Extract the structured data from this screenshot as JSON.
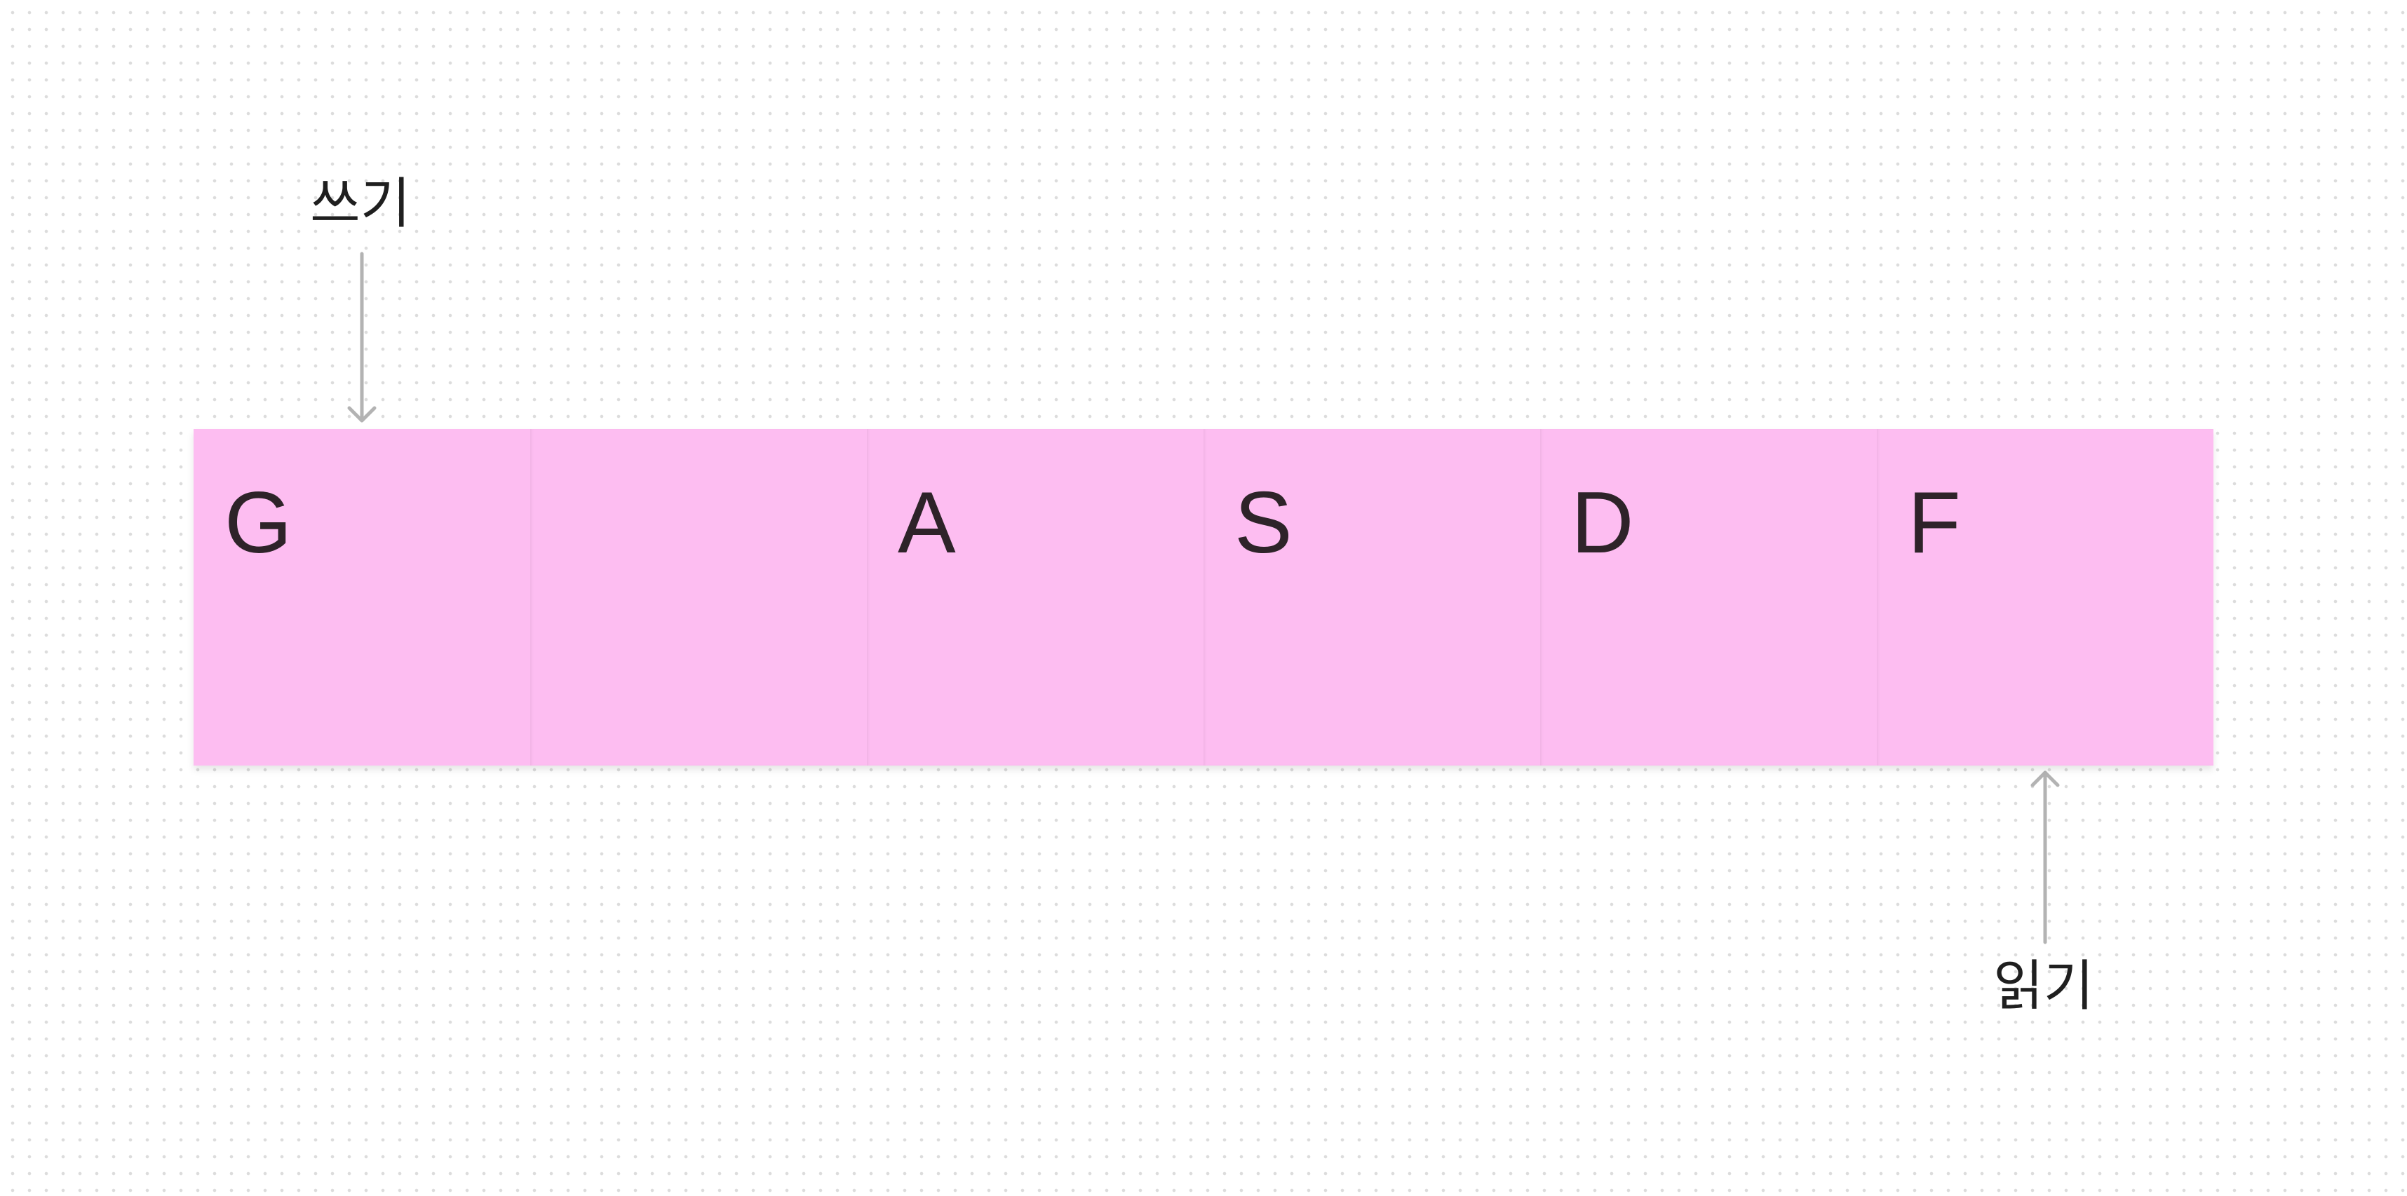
{
  "labels": {
    "write": "쓰기",
    "read": "읽기"
  },
  "buffer": {
    "cells": [
      "G",
      "",
      "A",
      "S",
      "D",
      "F"
    ],
    "cell_color": "#fdbdf1",
    "text_color": "#2e2329"
  },
  "arrows": {
    "color": "#b3b3b3",
    "write_arrow_points_to_cell": 0,
    "read_arrow_points_to_cell": 5
  }
}
